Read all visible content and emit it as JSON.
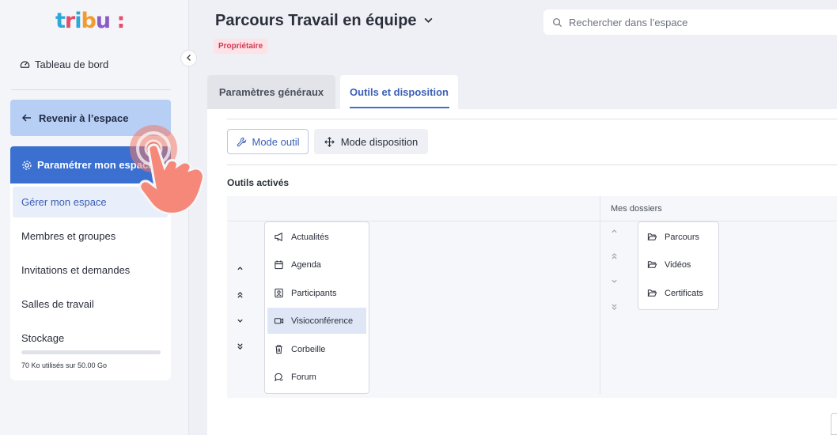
{
  "sidebar": {
    "logo_text": "tribu:",
    "dashboard_label": "Tableau de bord",
    "back_label": "Revenir à l’espace",
    "settings_label": "Paramétrer mon espace",
    "submenu": {
      "manage": "Gérer mon espace",
      "members": "Membres et groupes",
      "invitations": "Invitations et demandes",
      "rooms": "Salles de travail",
      "storage": "Stockage"
    },
    "storage_text": "70 Ko utilisés sur 50.00 Go",
    "storage_used_fraction": 0.0
  },
  "header": {
    "title": "Parcours Travail en équipe",
    "badge": "Propriétaire",
    "search_placeholder": "Rechercher dans l’espace"
  },
  "tabs": {
    "general": "Paramètres généraux",
    "tools": "Outils et disposition"
  },
  "modes": {
    "tool": "Mode outil",
    "layout": "Mode disposition"
  },
  "active_tools_label": "Outils activés",
  "folders_header": "Mes dossiers",
  "tools": [
    "Actualités",
    "Agenda",
    "Participants",
    "Visioconférence",
    "Corbeille",
    "Forum"
  ],
  "selected_tool": "Visioconférence",
  "folders": [
    "Parcours",
    "Vidéos",
    "Certificats"
  ],
  "colors": {
    "accent": "#3b6fd0",
    "back_button": "#b8cff5",
    "badge_bg": "#fde2e6",
    "badge_text": "#d03a56",
    "cursor": "#f07a6a"
  }
}
